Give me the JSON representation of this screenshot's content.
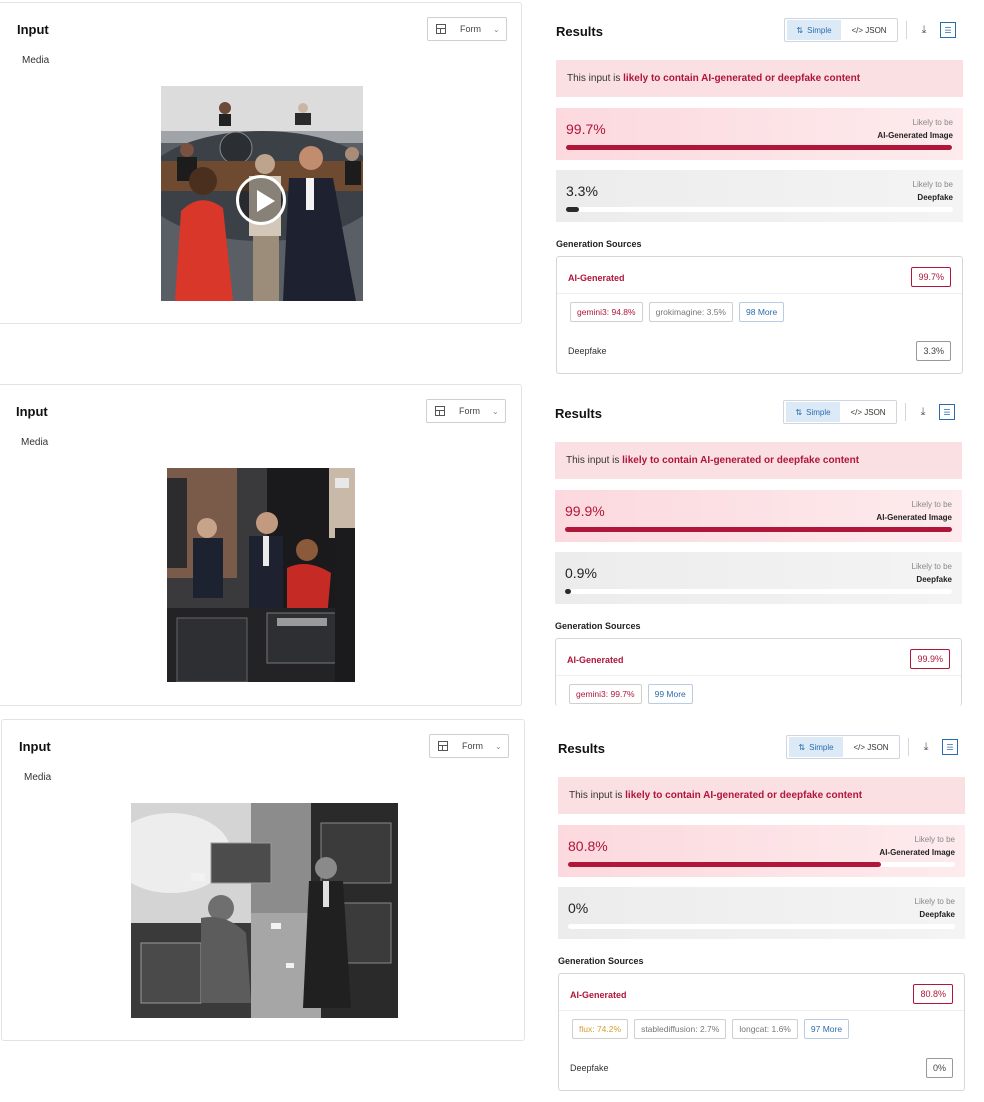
{
  "common": {
    "input_title": "Input",
    "media_label": "Media",
    "form_label": "Form",
    "results_title": "Results",
    "simple_label": "Simple",
    "json_label": "</> JSON",
    "banner_prefix": "This input is ",
    "banner_emphasis": "likely to contain AI-generated or deepfake content",
    "likely_to_be": "Likely to be",
    "ai_image_label": "AI-Generated Image",
    "deepfake_label": "Deepfake",
    "generation_sources_label": "Generation Sources",
    "ai_generated_label": "AI-Generated"
  },
  "icons": {
    "layout": "layout-grid-icon",
    "chevron": "chevron-down-icon",
    "simple": "simple-view-icon",
    "download": "download-icon",
    "list": "list-view-icon",
    "play": "play-icon"
  },
  "colors": {
    "accent": "#b0153a",
    "banner_bg": "#fbe0e3",
    "link": "#2b6cb0",
    "deepfake_bar": "#2a2a2a"
  },
  "results": [
    {
      "ai_pct": "99.7%",
      "ai_value": 0.997,
      "deepfake_pct": "3.3%",
      "deepfake_value": 0.033,
      "ai_badge": "99.7%",
      "chips": [
        {
          "text": "gemini3: 94.8%",
          "kind": "top"
        },
        {
          "text": "grokimagine: 3.5%",
          "kind": "normal"
        },
        {
          "text": "98 More",
          "kind": "more"
        }
      ],
      "deepfake_badge": "3.3%"
    },
    {
      "ai_pct": "99.9%",
      "ai_value": 0.999,
      "deepfake_pct": "0.9%",
      "deepfake_value": 0.009,
      "ai_badge": "99.9%",
      "chips": [
        {
          "text": "gemini3: 99.7%",
          "kind": "top"
        },
        {
          "text": "99 More",
          "kind": "more"
        }
      ]
    },
    {
      "ai_pct": "80.8%",
      "ai_value": 0.808,
      "deepfake_pct": "0%",
      "deepfake_value": 0.0,
      "ai_badge": "80.8%",
      "chips": [
        {
          "text": "flux: 74.2%",
          "kind": "flux"
        },
        {
          "text": "stablediffusion: 2.7%",
          "kind": "normal"
        },
        {
          "text": "longcat: 1.6%",
          "kind": "normal"
        },
        {
          "text": "97 More",
          "kind": "more"
        }
      ],
      "deepfake_badge": "0%"
    }
  ]
}
